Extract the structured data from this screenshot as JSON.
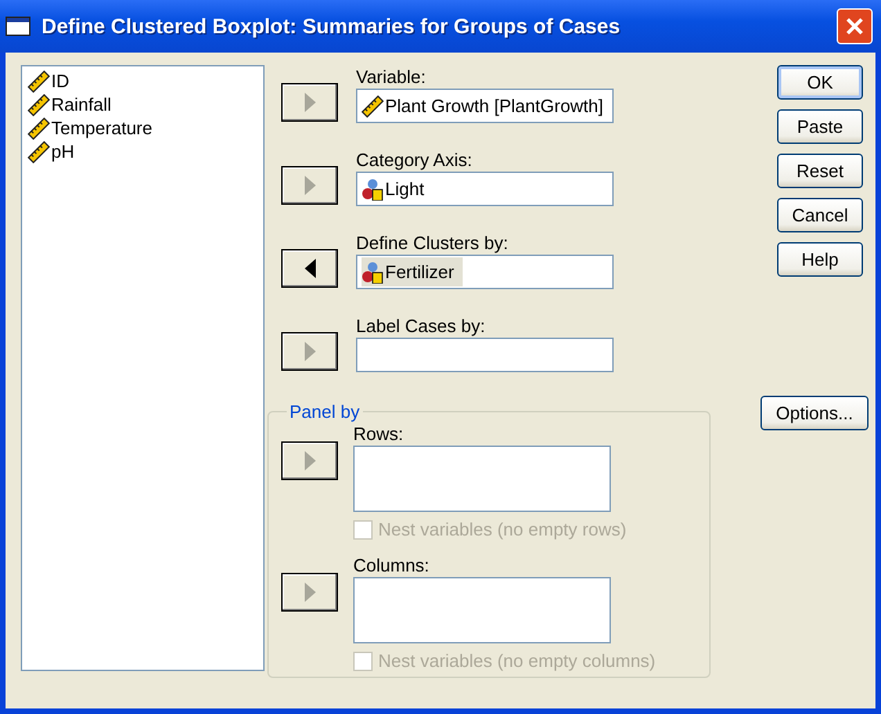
{
  "window": {
    "title": "Define Clustered Boxplot: Summaries for Groups of Cases"
  },
  "variable_list": [
    {
      "label": "ID",
      "kind": "scale"
    },
    {
      "label": "Rainfall",
      "kind": "scale"
    },
    {
      "label": "Temperature",
      "kind": "scale"
    },
    {
      "label": "pH",
      "kind": "scale"
    }
  ],
  "targets": [
    {
      "label": "Variable:",
      "kind": "right",
      "disabled": true,
      "value": {
        "label": "Plant Growth [PlantGrowth]",
        "kind": "scale",
        "selected": false
      }
    },
    {
      "label": "Category Axis:",
      "kind": "right",
      "disabled": true,
      "value": {
        "label": "Light",
        "kind": "nominal",
        "selected": false
      }
    },
    {
      "label": "Define Clusters by:",
      "kind": "left",
      "disabled": false,
      "value": {
        "label": "Fertilizer",
        "kind": "nominal",
        "selected": true
      }
    },
    {
      "label": "Label Cases by:",
      "kind": "right",
      "disabled": true
    }
  ],
  "panel_by": {
    "title": "Panel by",
    "sections": [
      {
        "label": "Rows:",
        "kind": "right",
        "disabled": true,
        "checkbox": {
          "label": "Nest variables (no empty rows)",
          "checked": false,
          "disabled": true
        }
      },
      {
        "label": "Columns:",
        "kind": "right",
        "disabled": true,
        "checkbox": {
          "label": "Nest variables (no empty columns)",
          "checked": false,
          "disabled": true
        }
      }
    ]
  },
  "buttons": [
    {
      "label": "OK",
      "selected": true
    },
    {
      "label": "Paste",
      "selected": false
    },
    {
      "label": "Reset",
      "selected": false
    },
    {
      "label": "Cancel",
      "selected": false
    },
    {
      "label": "Help",
      "selected": false
    }
  ],
  "options_button": "Options..."
}
